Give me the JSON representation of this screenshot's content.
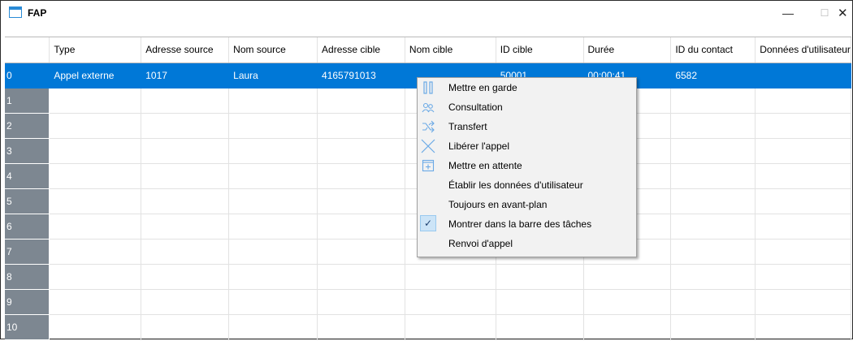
{
  "window": {
    "title": "FAP",
    "controls": {
      "minimize": "—",
      "maximize": "☐",
      "close": "✕"
    }
  },
  "table": {
    "columns": [
      "Type",
      "Adresse source",
      "Nom source",
      "Adresse cible",
      "Nom cible",
      "ID cible",
      "Durée",
      "ID du contact",
      "Données d'utilisateur"
    ],
    "rows": [
      {
        "num": "0",
        "cells": [
          "Appel externe",
          "1017",
          "Laura",
          "4165791013",
          "",
          "50001",
          "00:00:41",
          "6582",
          ""
        ]
      },
      {
        "num": "1",
        "cells": [
          "",
          "",
          "",
          "",
          "",
          "",
          "",
          "",
          ""
        ]
      },
      {
        "num": "2",
        "cells": [
          "",
          "",
          "",
          "",
          "",
          "",
          "",
          "",
          ""
        ]
      },
      {
        "num": "3",
        "cells": [
          "",
          "",
          "",
          "",
          "",
          "",
          "",
          "",
          ""
        ]
      },
      {
        "num": "4",
        "cells": [
          "",
          "",
          "",
          "",
          "",
          "",
          "",
          "",
          ""
        ]
      },
      {
        "num": "5",
        "cells": [
          "",
          "",
          "",
          "",
          "",
          "",
          "",
          "",
          ""
        ]
      },
      {
        "num": "6",
        "cells": [
          "",
          "",
          "",
          "",
          "",
          "",
          "",
          "",
          ""
        ]
      },
      {
        "num": "7",
        "cells": [
          "",
          "",
          "",
          "",
          "",
          "",
          "",
          "",
          ""
        ]
      },
      {
        "num": "8",
        "cells": [
          "",
          "",
          "",
          "",
          "",
          "",
          "",
          "",
          ""
        ]
      },
      {
        "num": "9",
        "cells": [
          "",
          "",
          "",
          "",
          "",
          "",
          "",
          "",
          ""
        ]
      },
      {
        "num": "10",
        "cells": [
          "",
          "",
          "",
          "",
          "",
          "",
          "",
          "",
          ""
        ]
      }
    ],
    "selected_row": "0"
  },
  "context_menu": {
    "items": [
      {
        "label": "Mettre en garde",
        "icon": "hold-icon"
      },
      {
        "label": "Consultation",
        "icon": "consultation-icon"
      },
      {
        "label": "Transfert",
        "icon": "transfer-icon"
      },
      {
        "label": "Libérer l'appel",
        "icon": "release-call-icon"
      },
      {
        "label": "Mettre en attente",
        "icon": "queue-icon"
      },
      {
        "label": "Établir les données d'utilisateur",
        "icon": ""
      },
      {
        "label": "Toujours en avant-plan",
        "icon": ""
      },
      {
        "label": "Montrer dans la barre des tâches",
        "icon": "checkmark-icon",
        "checked": true
      },
      {
        "label": "Renvoi d'appel",
        "icon": ""
      }
    ]
  },
  "colors": {
    "selection": "#0078d7",
    "row_header": "#7d8791",
    "menu_background": "#f2f2f2",
    "icon_blue": "#6aa9e6"
  }
}
